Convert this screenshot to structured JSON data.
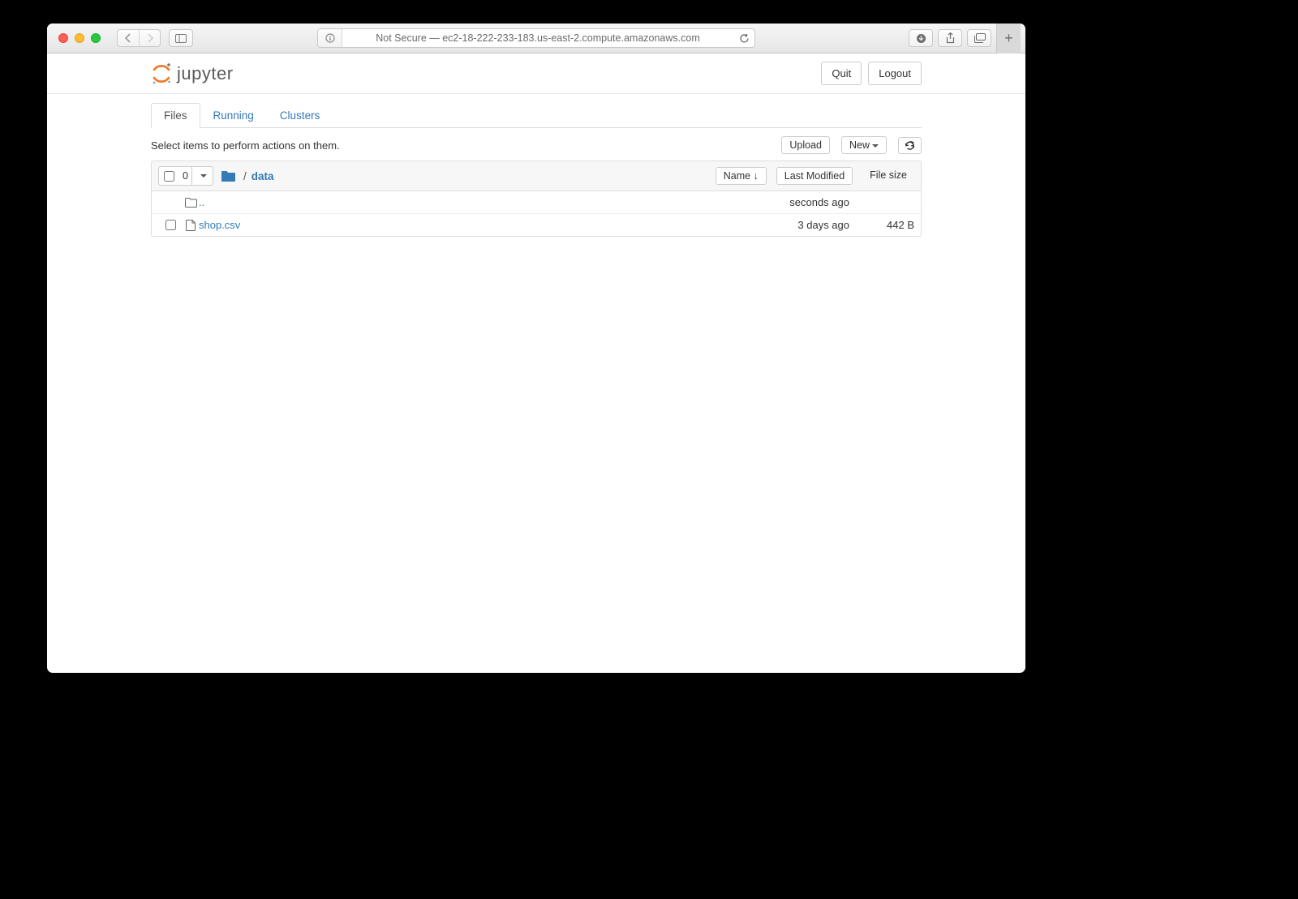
{
  "browser": {
    "address": "Not Secure — ec2-18-222-233-183.us-east-2.compute.amazonaws.com"
  },
  "header": {
    "logo_text": "jupyter",
    "quit_label": "Quit",
    "logout_label": "Logout"
  },
  "tabs": {
    "items": [
      {
        "label": "Files",
        "active": true
      },
      {
        "label": "Running",
        "active": false
      },
      {
        "label": "Clusters",
        "active": false
      }
    ]
  },
  "toolbar": {
    "hint": "Select items to perform actions on them.",
    "upload_label": "Upload",
    "new_label": "New"
  },
  "list_header": {
    "selected_count": "0",
    "breadcrumb_current": "data",
    "name_col": "Name",
    "modified_col": "Last Modified",
    "size_col": "File size"
  },
  "rows": [
    {
      "icon": "folder-open",
      "name": "..",
      "is_link": true,
      "checkbox": false,
      "modified": "seconds ago",
      "size": ""
    },
    {
      "icon": "file",
      "name": "shop.csv",
      "is_link": true,
      "checkbox": true,
      "modified": "3 days ago",
      "size": "442 B"
    }
  ]
}
